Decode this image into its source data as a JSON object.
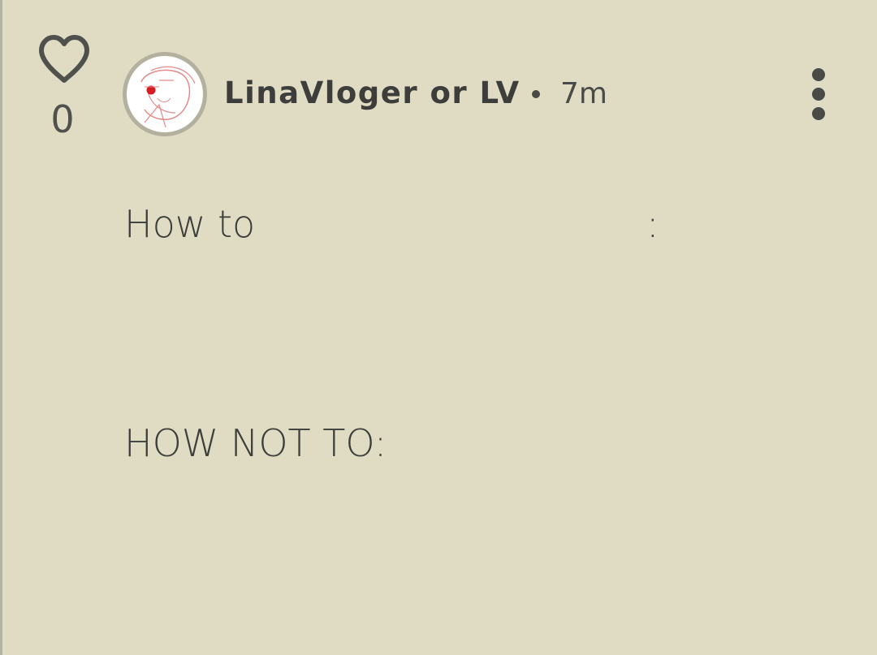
{
  "post": {
    "likes": "0",
    "author": "LinaVloger or LV",
    "time": "7m",
    "lines": [
      "How to",
      ":",
      "HOW NOT TO:"
    ]
  },
  "icons": {
    "like": "heart-outline-icon",
    "menu": "vertical-dots-icon"
  },
  "colors": {
    "background": "#dfdcc3",
    "text": "#3d3d3b",
    "avatar_ring": "#b3b19e",
    "left_border": "#b4b2a0"
  }
}
